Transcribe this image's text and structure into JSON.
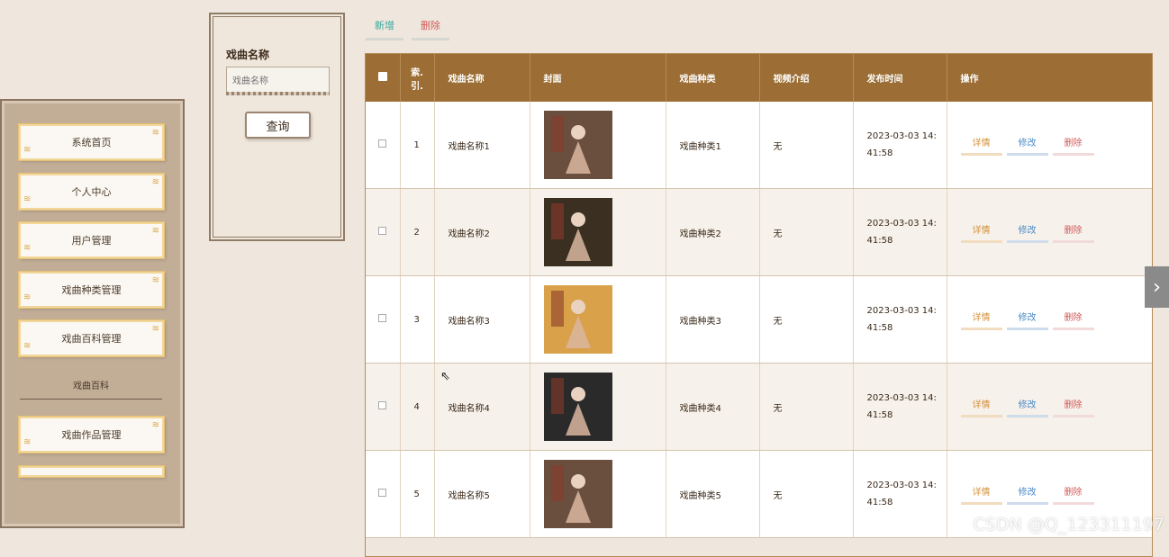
{
  "sidebar": {
    "items": [
      {
        "label": "系统首页"
      },
      {
        "label": "个人中心"
      },
      {
        "label": "用户管理"
      },
      {
        "label": "戏曲种类管理"
      },
      {
        "label": "戏曲百科管理"
      }
    ],
    "section_title": "戏曲百科",
    "items2": [
      {
        "label": "戏曲作品管理"
      }
    ]
  },
  "search": {
    "label": "戏曲名称",
    "placeholder": "戏曲名称",
    "button": "查询"
  },
  "actions": {
    "add": "新增",
    "delete": "删除"
  },
  "table": {
    "headers": [
      "索引",
      "戏曲名称",
      "封面",
      "戏曲种类",
      "视频介绍",
      "发布时间",
      "操作"
    ],
    "index_header_lines": [
      "索.",
      "引."
    ],
    "rows": [
      {
        "index": "1",
        "name": "戏曲名称1",
        "type": "戏曲种类1",
        "video": "无",
        "time": "2023-03-03 14:41:58",
        "cover_color": "#6a4f3f"
      },
      {
        "index": "2",
        "name": "戏曲名称2",
        "type": "戏曲种类2",
        "video": "无",
        "time": "2023-03-03 14:41:58",
        "cover_color": "#3b2f22"
      },
      {
        "index": "3",
        "name": "戏曲名称3",
        "type": "戏曲种类3",
        "video": "无",
        "time": "2023-03-03 14:41:58",
        "cover_color": "#d9a24a"
      },
      {
        "index": "4",
        "name": "戏曲名称4",
        "type": "戏曲种类4",
        "video": "无",
        "time": "2023-03-03 14:41:58",
        "cover_color": "#2a2a2a"
      },
      {
        "index": "5",
        "name": "戏曲名称5",
        "type": "戏曲种类5",
        "video": "无",
        "time": "2023-03-03 14:41:58",
        "cover_color": "#6a4f3f"
      }
    ],
    "ops": {
      "detail": "详情",
      "edit": "修改",
      "remove": "删除"
    }
  },
  "watermark": "CSDN @Q_123311197",
  "colors": {
    "header": "#9c6e35",
    "accent_add": "#3aa8a0",
    "accent_delete": "#d15a5a"
  }
}
